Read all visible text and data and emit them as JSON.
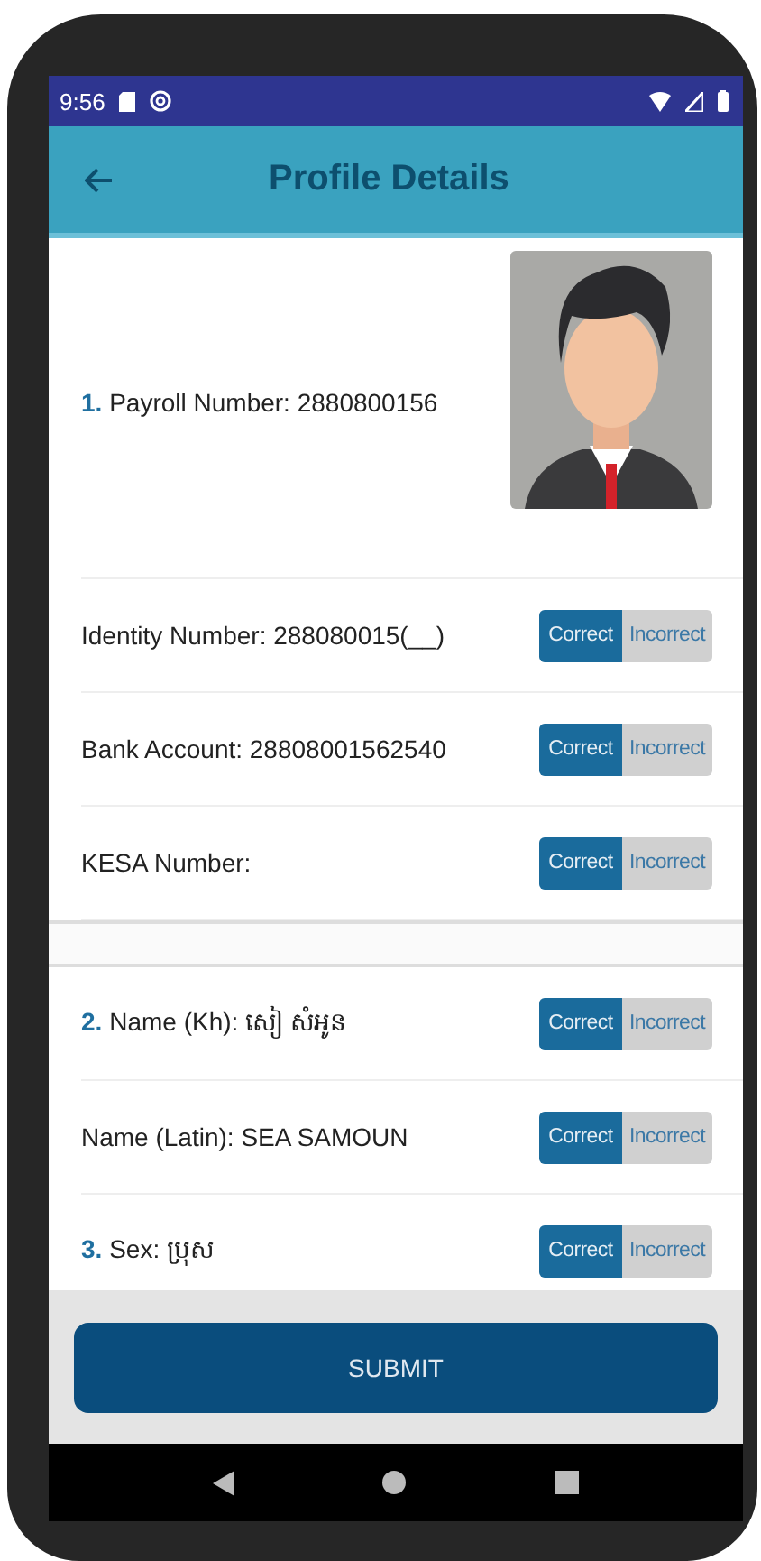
{
  "status_bar": {
    "time": "9:56"
  },
  "app_bar": {
    "title": "Profile Details"
  },
  "sections": [
    {
      "fields": [
        {
          "kind": "photo",
          "number": "1.",
          "label": "Payroll Number: 2880800156"
        },
        {
          "kind": "verify",
          "label": "Identity Number: 288080015(__)",
          "options": [
            {
              "label": "Correct",
              "selected": true
            },
            {
              "label": "Incorrect",
              "selected": false
            }
          ]
        },
        {
          "kind": "verify",
          "label": "Bank Account: 28808001562540",
          "options": [
            {
              "label": "Correct",
              "selected": true
            },
            {
              "label": "Incorrect",
              "selected": false
            }
          ]
        },
        {
          "kind": "verify",
          "label": "KESA Number:",
          "options": [
            {
              "label": "Correct",
              "selected": true
            },
            {
              "label": "Incorrect",
              "selected": false
            }
          ]
        }
      ]
    },
    {
      "fields": [
        {
          "kind": "verify",
          "number": "2.",
          "label": "Name (Kh): សៀ សំអូន",
          "options": [
            {
              "label": "Correct",
              "selected": true
            },
            {
              "label": "Incorrect",
              "selected": false
            }
          ]
        },
        {
          "kind": "verify",
          "label": "Name (Latin): SEA SAMOUN",
          "options": [
            {
              "label": "Correct",
              "selected": true
            },
            {
              "label": "Incorrect",
              "selected": false
            }
          ]
        },
        {
          "kind": "verify",
          "number": "3.",
          "label": "Sex: ប្រុស",
          "options": [
            {
              "label": "Correct",
              "selected": true
            },
            {
              "label": "Incorrect",
              "selected": false
            }
          ]
        }
      ]
    }
  ],
  "submit_button": "SUBMIT"
}
